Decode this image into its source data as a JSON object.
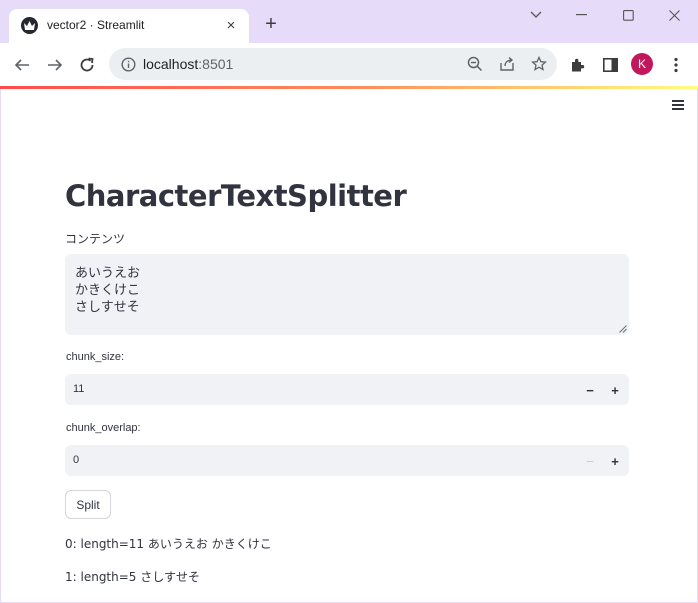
{
  "browser": {
    "tab_title": "vector2 · Streamlit",
    "tab_close": "×",
    "new_tab": "+",
    "url_host": "localhost",
    "url_port": ":8501",
    "profile_initial": "K"
  },
  "app": {
    "title": "CharacterTextSplitter",
    "content_label": "コンテンツ",
    "content_value": "あいうえお\nかきくけこ\nさしすせそ",
    "chunk_size_label": "chunk_size:",
    "chunk_size_value": "11",
    "chunk_overlap_label": "chunk_overlap:",
    "chunk_overlap_value": "0",
    "minus": "−",
    "plus": "+",
    "split_label": "Split",
    "results": [
      "0: length=11 あいうえお かきくけこ",
      "1: length=5 さしすせそ"
    ]
  },
  "colors": {
    "accent": "#ff4b4b",
    "titlebar": "#e7dbfa",
    "input_bg": "#f0f2f6",
    "text": "#31333f",
    "avatar": "#c2185b"
  }
}
